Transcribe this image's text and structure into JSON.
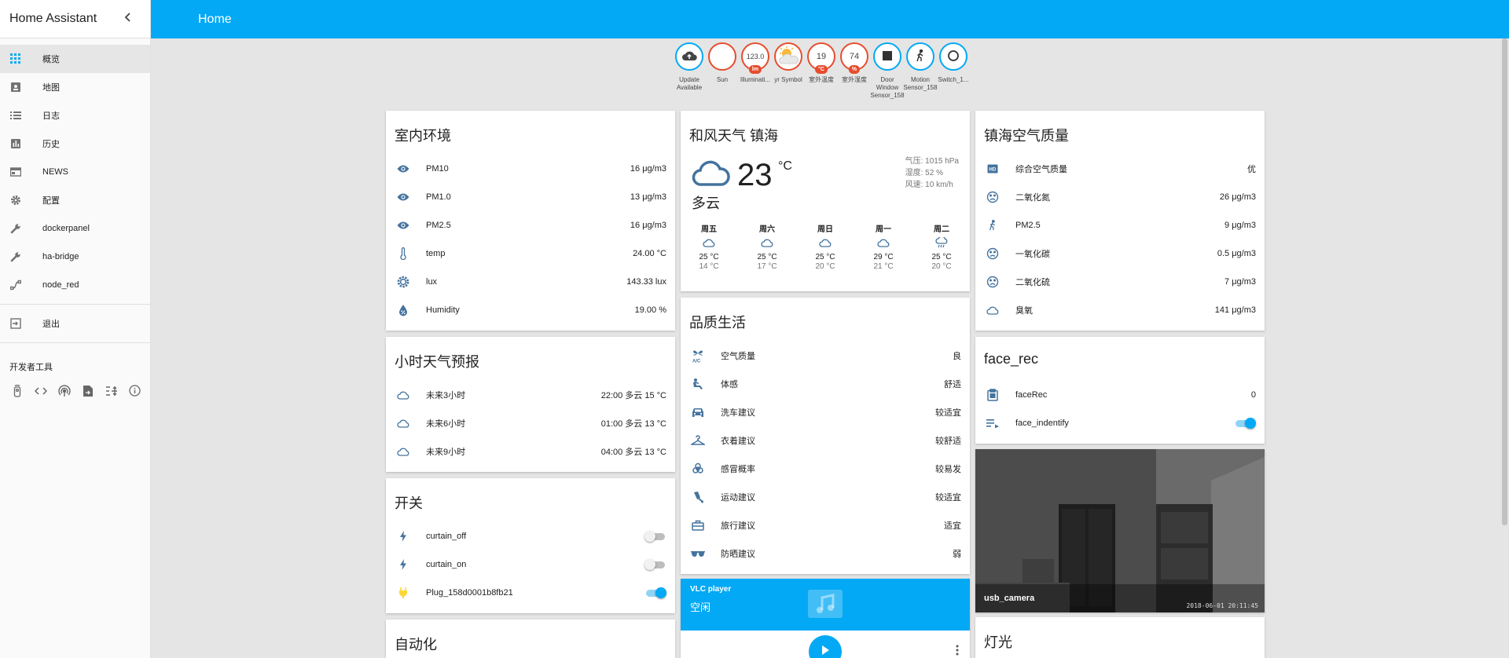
{
  "app": {
    "title": "Home Assistant",
    "page_title": "Home"
  },
  "colors": {
    "accent": "#03a9f4",
    "icon": "#44739e",
    "badge_red": "#e54d2e"
  },
  "sidebar": {
    "items": [
      {
        "label": "概览",
        "icon": "grid-icon"
      },
      {
        "label": "地图",
        "icon": "map-icon"
      },
      {
        "label": "日志",
        "icon": "list-icon"
      },
      {
        "label": "历史",
        "icon": "chart-icon"
      },
      {
        "label": "NEWS",
        "icon": "news-icon"
      },
      {
        "label": "配置",
        "icon": "gear-icon"
      },
      {
        "label": "dockerpanel",
        "icon": "wrench-icon"
      },
      {
        "label": "ha-bridge",
        "icon": "wrench-icon"
      },
      {
        "label": "node_red",
        "icon": "node-icon"
      }
    ],
    "logout": "退出",
    "dev_tools_title": "开发者工具"
  },
  "badges": [
    {
      "label": "Update Available",
      "icon": "cloud-upload-icon"
    },
    {
      "label": "Sun",
      "icon": "moon-icon"
    },
    {
      "label": "Illuminati...",
      "value": "123.0",
      "unit": "lm"
    },
    {
      "label": "yr Symbol",
      "icon": "partly-sunny-icon"
    },
    {
      "label": "室外温度",
      "value": "19",
      "unit": "°C"
    },
    {
      "label": "室外湿度",
      "value": "74",
      "unit": "%"
    },
    {
      "label": "Door Window Sensor_158",
      "icon": "square-icon"
    },
    {
      "label": "Motion Sensor_158",
      "icon": "walk-icon"
    },
    {
      "label": "Switch_1...",
      "icon": "circle-icon"
    }
  ],
  "indoor": {
    "title": "室内环境",
    "rows": [
      {
        "name": "PM10",
        "value": "16 μg/m3"
      },
      {
        "name": "PM1.0",
        "value": "13 μg/m3"
      },
      {
        "name": "PM2.5",
        "value": "16 μg/m3"
      },
      {
        "name": "temp",
        "value": "24.00 °C"
      },
      {
        "name": "lux",
        "value": "143.33 lux"
      },
      {
        "name": "Humidity",
        "value": "19.00 %"
      }
    ]
  },
  "hourly": {
    "title": "小时天气预报",
    "rows": [
      {
        "name": "未来3小时",
        "value": "22:00 多云 15 °C"
      },
      {
        "name": "未来6小时",
        "value": "01:00 多云 13 °C"
      },
      {
        "name": "未来9小时",
        "value": "04:00 多云 13 °C"
      }
    ]
  },
  "switches": {
    "title": "开关",
    "rows": [
      {
        "name": "curtain_off",
        "on": false
      },
      {
        "name": "curtain_on",
        "on": false
      },
      {
        "name": "Plug_158d0001b8fb21",
        "on": true
      }
    ]
  },
  "automation": {
    "title": "自动化"
  },
  "weather": {
    "title": "和风天气 镇海",
    "temp": "23",
    "unit": "°C",
    "state": "多云",
    "pressure": "气压: 1015 hPa",
    "humidity": "湿度: 52 %",
    "wind": "风速: 10 km/h",
    "forecast": [
      {
        "day": "周五",
        "hi": "25 °C",
        "lo": "14 °C",
        "icon": "cloud-icon"
      },
      {
        "day": "周六",
        "hi": "25 °C",
        "lo": "17 °C",
        "icon": "cloud-icon"
      },
      {
        "day": "周日",
        "hi": "25 °C",
        "lo": "20 °C",
        "icon": "cloud-icon"
      },
      {
        "day": "周一",
        "hi": "29 °C",
        "lo": "21 °C",
        "icon": "cloud-icon"
      },
      {
        "day": "周二",
        "hi": "25 °C",
        "lo": "20 °C",
        "icon": "rain-icon"
      }
    ]
  },
  "life": {
    "title": "品质生活",
    "rows": [
      {
        "name": "空气质量",
        "value": "良"
      },
      {
        "name": "体感",
        "value": "舒适"
      },
      {
        "name": "洗车建议",
        "value": "较适宜"
      },
      {
        "name": "衣着建议",
        "value": "较舒适"
      },
      {
        "name": "感冒概率",
        "value": "较易发"
      },
      {
        "name": "运动建议",
        "value": "较适宜"
      },
      {
        "name": "旅行建议",
        "value": "适宜"
      },
      {
        "name": "防晒建议",
        "value": "弱"
      }
    ]
  },
  "media": {
    "name": "VLC player",
    "state": "空闲"
  },
  "air": {
    "title": "镇海空气质量",
    "rows": [
      {
        "name": "综合空气质量",
        "value": "优"
      },
      {
        "name": "二氧化氮",
        "value": "26 μg/m3"
      },
      {
        "name": "PM2.5",
        "value": "9 μg/m3"
      },
      {
        "name": "一氧化碳",
        "value": "0.5 μg/m3"
      },
      {
        "name": "二氧化硫",
        "value": "7 μg/m3"
      },
      {
        "name": "臭氧",
        "value": "141 μg/m3"
      }
    ]
  },
  "face": {
    "title": "face_rec",
    "rows": [
      {
        "name": "faceRec",
        "value": "0"
      },
      {
        "name": "face_indentify",
        "on": true
      }
    ]
  },
  "camera": {
    "name": "usb_camera",
    "timestamp": "2018-06-01 20:11:45"
  },
  "lights": {
    "title": "灯光"
  }
}
